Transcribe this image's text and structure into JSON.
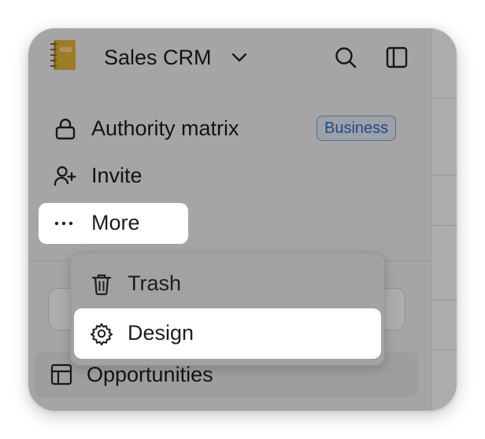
{
  "workspace": {
    "name": "Sales CRM",
    "icon": "notebook-icon",
    "dropdown_icon": "chevron-down-icon"
  },
  "header": {
    "search_icon": "search-icon",
    "sidebar_toggle_icon": "sidebar-toggle-icon"
  },
  "nav": {
    "items": [
      {
        "label": "Authority matrix",
        "icon": "lock-icon",
        "badge": "Business"
      },
      {
        "label": "Invite",
        "icon": "user-plus-icon"
      },
      {
        "label": "More",
        "icon": "more-horizontal-icon"
      }
    ]
  },
  "more_menu": {
    "items": [
      {
        "label": "Trash",
        "icon": "trash-icon"
      },
      {
        "label": "Design",
        "icon": "gear-icon"
      }
    ]
  },
  "pages": [
    {
      "label": "Opportunities",
      "icon": "table-icon"
    }
  ],
  "colors": {
    "badge_text": "#2f6fc1",
    "badge_border": "#7ea8d8",
    "overlay": "rgba(0,0,0,0.32)"
  }
}
